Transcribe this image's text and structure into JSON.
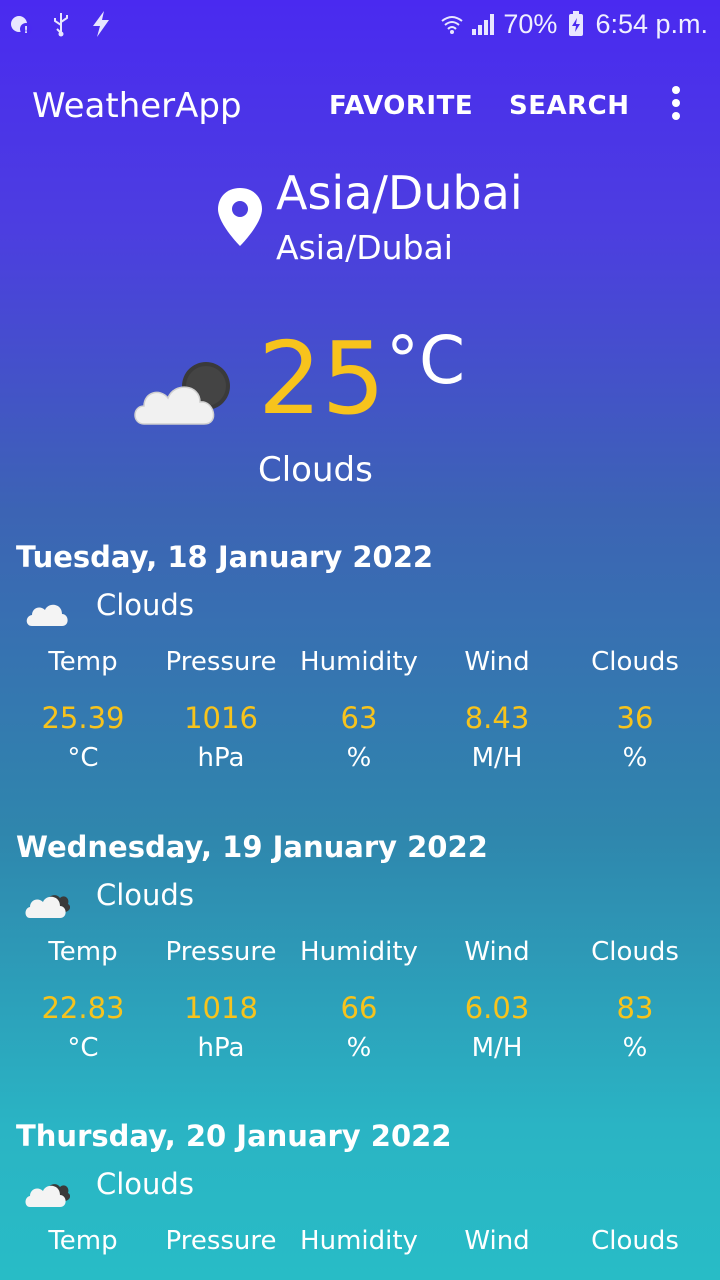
{
  "status_bar": {
    "battery_percent": "70%",
    "time": "6:54 p.m.",
    "icons": [
      "notification-icon",
      "usb-icon",
      "charging-bolt-icon",
      "wifi-icon",
      "signal-icon",
      "battery-icon"
    ]
  },
  "app_bar": {
    "title": "WeatherApp",
    "favorite_label": "FAVORITE",
    "search_label": "SEARCH",
    "overflow_icon": "more-vert-icon"
  },
  "location": {
    "title": "Asia/Dubai",
    "subtitle": "Asia/Dubai",
    "icon": "location-pin-icon"
  },
  "current": {
    "temp": "25",
    "unit": "°C",
    "description": "Clouds",
    "icon": "cloud-moon-icon"
  },
  "colors": {
    "accent": "#f7c31c",
    "gradient_top": "#4a2af0",
    "gradient_bottom": "#28bcc6"
  },
  "forecast": [
    {
      "date": "Tuesday, 18 January 2022",
      "description": "Clouds",
      "icon": "cloud-icon",
      "metrics": [
        {
          "label": "Temp",
          "value": "25.39",
          "unit": "°C"
        },
        {
          "label": "Pressure",
          "value": "1016",
          "unit": "hPa"
        },
        {
          "label": "Humidity",
          "value": "63",
          "unit": "%"
        },
        {
          "label": "Wind",
          "value": "8.43",
          "unit": "M/H"
        },
        {
          "label": "Clouds",
          "value": "36",
          "unit": "%"
        }
      ]
    },
    {
      "date": "Wednesday, 19 January 2022",
      "description": "Clouds",
      "icon": "broken-clouds-icon",
      "metrics": [
        {
          "label": "Temp",
          "value": "22.83",
          "unit": "°C"
        },
        {
          "label": "Pressure",
          "value": "1018",
          "unit": "hPa"
        },
        {
          "label": "Humidity",
          "value": "66",
          "unit": "%"
        },
        {
          "label": "Wind",
          "value": "6.03",
          "unit": "M/H"
        },
        {
          "label": "Clouds",
          "value": "83",
          "unit": "%"
        }
      ]
    },
    {
      "date": "Thursday, 20 January 2022",
      "description": "Clouds",
      "icon": "broken-clouds-icon",
      "metrics": [
        {
          "label": "Temp"
        },
        {
          "label": "Pressure"
        },
        {
          "label": "Humidity"
        },
        {
          "label": "Wind"
        },
        {
          "label": "Clouds"
        }
      ]
    }
  ]
}
